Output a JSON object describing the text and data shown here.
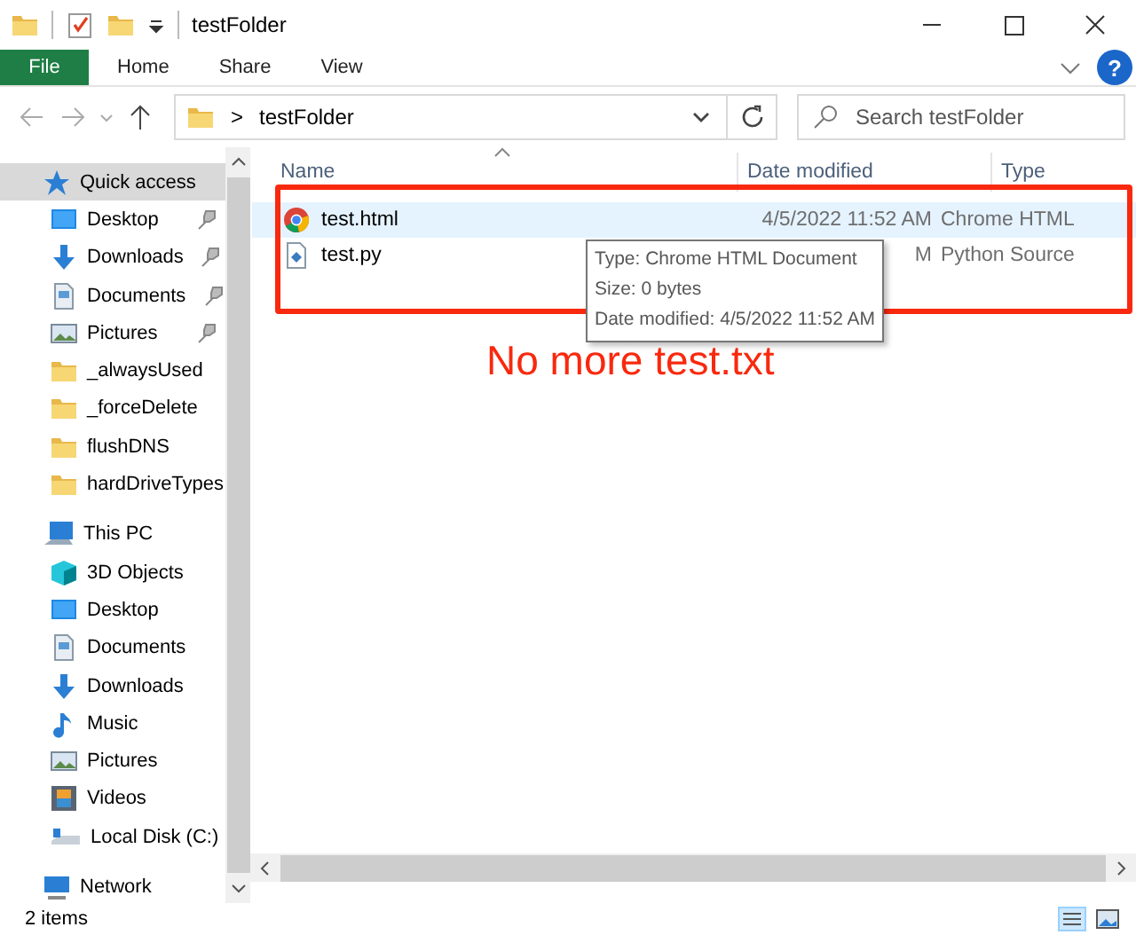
{
  "window": {
    "title": "testFolder"
  },
  "ribbon": {
    "tabs": [
      {
        "label": "File",
        "selected": true
      },
      {
        "label": "Home",
        "selected": false
      },
      {
        "label": "Share",
        "selected": false
      },
      {
        "label": "View",
        "selected": false
      }
    ],
    "help": "?"
  },
  "address": {
    "separator": ">",
    "path": "testFolder"
  },
  "search": {
    "placeholder": "Search testFolder"
  },
  "sidebar": {
    "items": [
      {
        "label": "Quick access",
        "kind": "star",
        "selected": true,
        "children": [
          {
            "label": "Desktop",
            "kind": "desktop",
            "pinned": true
          },
          {
            "label": "Downloads",
            "kind": "download",
            "pinned": true
          },
          {
            "label": "Documents",
            "kind": "document",
            "pinned": true
          },
          {
            "label": "Pictures",
            "kind": "picture",
            "pinned": true
          },
          {
            "label": "_alwaysUsed",
            "kind": "folder",
            "pinned": false
          },
          {
            "label": "_forceDelete",
            "kind": "folder",
            "pinned": false
          },
          {
            "label": "flushDNS",
            "kind": "folder",
            "pinned": false
          },
          {
            "label": "hardDriveTypes",
            "kind": "folder",
            "pinned": false
          }
        ]
      },
      {
        "label": "This PC",
        "kind": "pc",
        "selected": false,
        "children": [
          {
            "label": "3D Objects",
            "kind": "cube",
            "pinned": false
          },
          {
            "label": "Desktop",
            "kind": "desktop",
            "pinned": false
          },
          {
            "label": "Documents",
            "kind": "document",
            "pinned": false
          },
          {
            "label": "Downloads",
            "kind": "download",
            "pinned": false
          },
          {
            "label": "Music",
            "kind": "music",
            "pinned": false
          },
          {
            "label": "Pictures",
            "kind": "picture",
            "pinned": false
          },
          {
            "label": "Videos",
            "kind": "video",
            "pinned": false
          },
          {
            "label": "Local Disk (C:)",
            "kind": "disk",
            "pinned": false
          }
        ]
      },
      {
        "label": "Network",
        "kind": "network",
        "selected": false
      }
    ]
  },
  "table": {
    "columns": [
      "Name",
      "Date modified",
      "Type"
    ],
    "rows": [
      {
        "name": "test.html",
        "kind": "chrome",
        "date_modified": "4/5/2022 11:52 AM",
        "type": "Chrome HTML",
        "highlighted": true
      },
      {
        "name": "test.py",
        "kind": "python",
        "date_modified": "M",
        "type": "Python Source",
        "highlighted": false
      }
    ]
  },
  "tooltip": {
    "lines": [
      "Type: Chrome HTML Document",
      "Size: 0 bytes",
      "Date modified: 4/5/2022 11:52 AM"
    ]
  },
  "annotation": {
    "text": "No more test.txt"
  },
  "status_bar": {
    "text": "2 items"
  }
}
